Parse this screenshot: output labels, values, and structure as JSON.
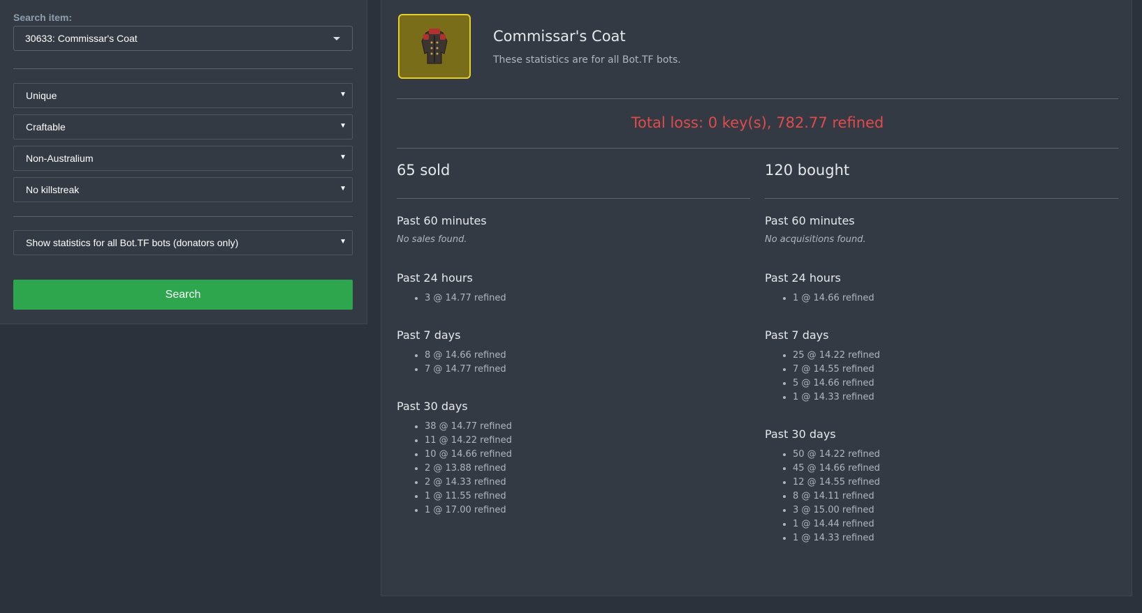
{
  "sidebar": {
    "search_label": "Search item:",
    "item_value": "30633: Commissar's Coat",
    "quality": "Unique",
    "craftable": "Craftable",
    "australium": "Non-Australium",
    "killstreak": "No killstreak",
    "scope": "Show statistics for all Bot.TF bots (donators only)",
    "search_button": "Search"
  },
  "item": {
    "name": "Commissar's Coat",
    "subtitle": "These statistics are for all Bot.TF bots.",
    "icon": "commissars-coat-item-image"
  },
  "summary": {
    "total": "Total loss: 0 key(s), 782.77 refined",
    "total_color": "#e04b4b"
  },
  "sold": {
    "title": "65 sold",
    "periods": [
      {
        "label": "Past 60 minutes",
        "empty": "No sales found.",
        "entries": []
      },
      {
        "label": "Past 24 hours",
        "entries": [
          "3 @ 14.77 refined"
        ]
      },
      {
        "label": "Past 7 days",
        "entries": [
          "8 @ 14.66 refined",
          "7 @ 14.77 refined"
        ]
      },
      {
        "label": "Past 30 days",
        "entries": [
          "38 @ 14.77 refined",
          "11 @ 14.22 refined",
          "10 @ 14.66 refined",
          "2 @ 13.88 refined",
          "2 @ 14.33 refined",
          "1 @ 11.55 refined",
          "1 @ 17.00 refined"
        ]
      }
    ]
  },
  "bought": {
    "title": "120 bought",
    "periods": [
      {
        "label": "Past 60 minutes",
        "empty": "No acquisitions found.",
        "entries": []
      },
      {
        "label": "Past 24 hours",
        "entries": [
          "1 @ 14.66 refined"
        ]
      },
      {
        "label": "Past 7 days",
        "entries": [
          "25 @ 14.22 refined",
          "7 @ 14.55 refined",
          "5 @ 14.66 refined",
          "1 @ 14.33 refined"
        ]
      },
      {
        "label": "Past 30 days",
        "entries": [
          "50 @ 14.22 refined",
          "45 @ 14.66 refined",
          "12 @ 14.55 refined",
          "8 @ 14.11 refined",
          "3 @ 15.00 refined",
          "1 @ 14.44 refined",
          "1 @ 14.33 refined"
        ]
      }
    ]
  }
}
